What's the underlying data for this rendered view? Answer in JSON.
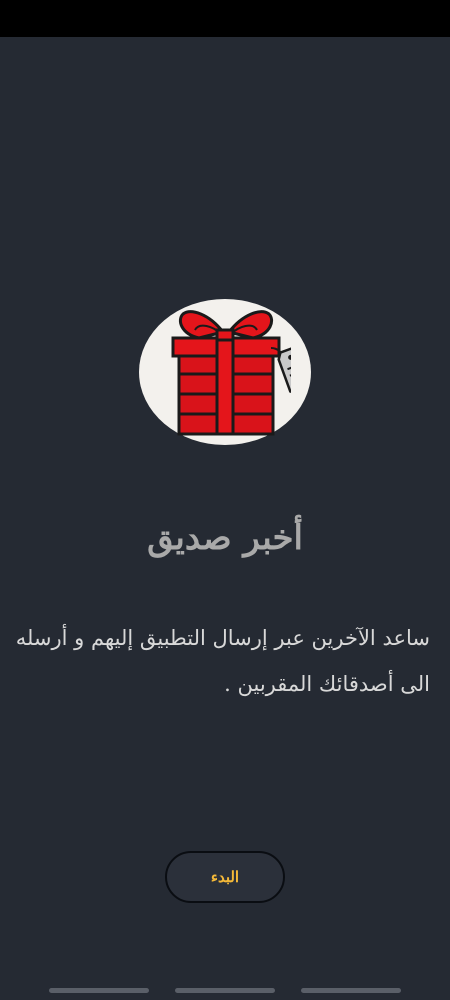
{
  "onboarding": {
    "title": "أخبر صديق",
    "description": "ساعد الآخرين عبر إرسال التطبيق إليهم و أرسله الى أصدقائك المقربين .",
    "icon": "gift-icon",
    "start_button_label": "البدء"
  },
  "colors": {
    "background": "#252a33",
    "title": "#a9a9a9",
    "description": "#d8d8d8",
    "button_text": "#f5b938",
    "gift": "#e4151b"
  },
  "pager": {
    "pages": 3
  }
}
